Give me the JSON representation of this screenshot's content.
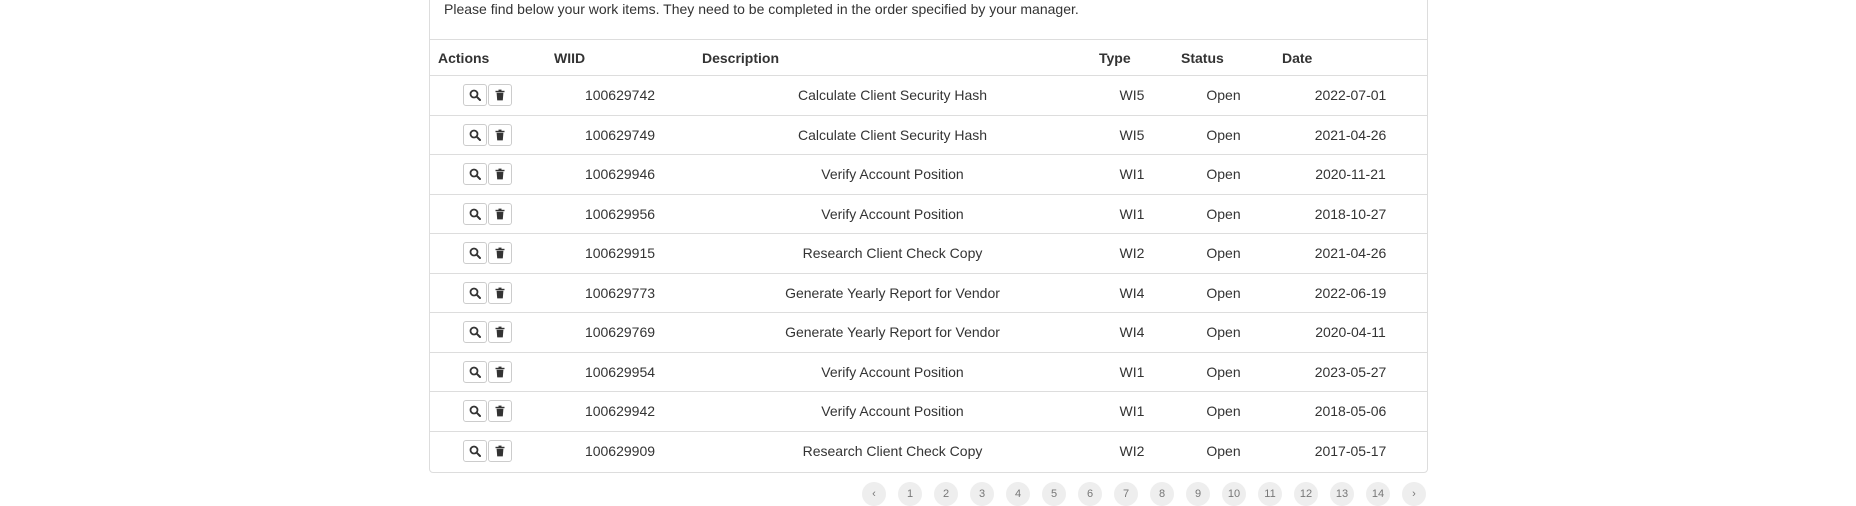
{
  "intro_text": "Please find below your work items. They need to be completed in the order specified by your manager.",
  "table": {
    "headers": {
      "actions": "Actions",
      "wiid": "WIID",
      "description": "Description",
      "type": "Type",
      "status": "Status",
      "date": "Date"
    },
    "rows": [
      {
        "wiid": "100629742",
        "description": "Calculate Client Security Hash",
        "type": "WI5",
        "status": "Open",
        "date": "2022-07-01"
      },
      {
        "wiid": "100629749",
        "description": "Calculate Client Security Hash",
        "type": "WI5",
        "status": "Open",
        "date": "2021-04-26"
      },
      {
        "wiid": "100629946",
        "description": "Verify Account Position",
        "type": "WI1",
        "status": "Open",
        "date": "2020-11-21"
      },
      {
        "wiid": "100629956",
        "description": "Verify Account Position",
        "type": "WI1",
        "status": "Open",
        "date": "2018-10-27"
      },
      {
        "wiid": "100629915",
        "description": "Research Client Check Copy",
        "type": "WI2",
        "status": "Open",
        "date": "2021-04-26"
      },
      {
        "wiid": "100629773",
        "description": "Generate Yearly Report for Vendor",
        "type": "WI4",
        "status": "Open",
        "date": "2022-06-19"
      },
      {
        "wiid": "100629769",
        "description": "Generate Yearly Report for Vendor",
        "type": "WI4",
        "status": "Open",
        "date": "2020-04-11"
      },
      {
        "wiid": "100629954",
        "description": "Verify Account Position",
        "type": "WI1",
        "status": "Open",
        "date": "2023-05-27"
      },
      {
        "wiid": "100629942",
        "description": "Verify Account Position",
        "type": "WI1",
        "status": "Open",
        "date": "2018-05-06"
      },
      {
        "wiid": "100629909",
        "description": "Research Client Check Copy",
        "type": "WI2",
        "status": "Open",
        "date": "2017-05-17"
      }
    ]
  },
  "icons": {
    "view": "magnifier-icon",
    "delete": "trash-icon"
  },
  "pagination": {
    "pages": [
      "‹",
      "1",
      "2",
      "3",
      "4",
      "5",
      "6",
      "7",
      "8",
      "9",
      "10",
      "11",
      "12",
      "13",
      "14",
      "›"
    ]
  },
  "colors": {
    "border": "#dddddd",
    "text": "#333333"
  }
}
